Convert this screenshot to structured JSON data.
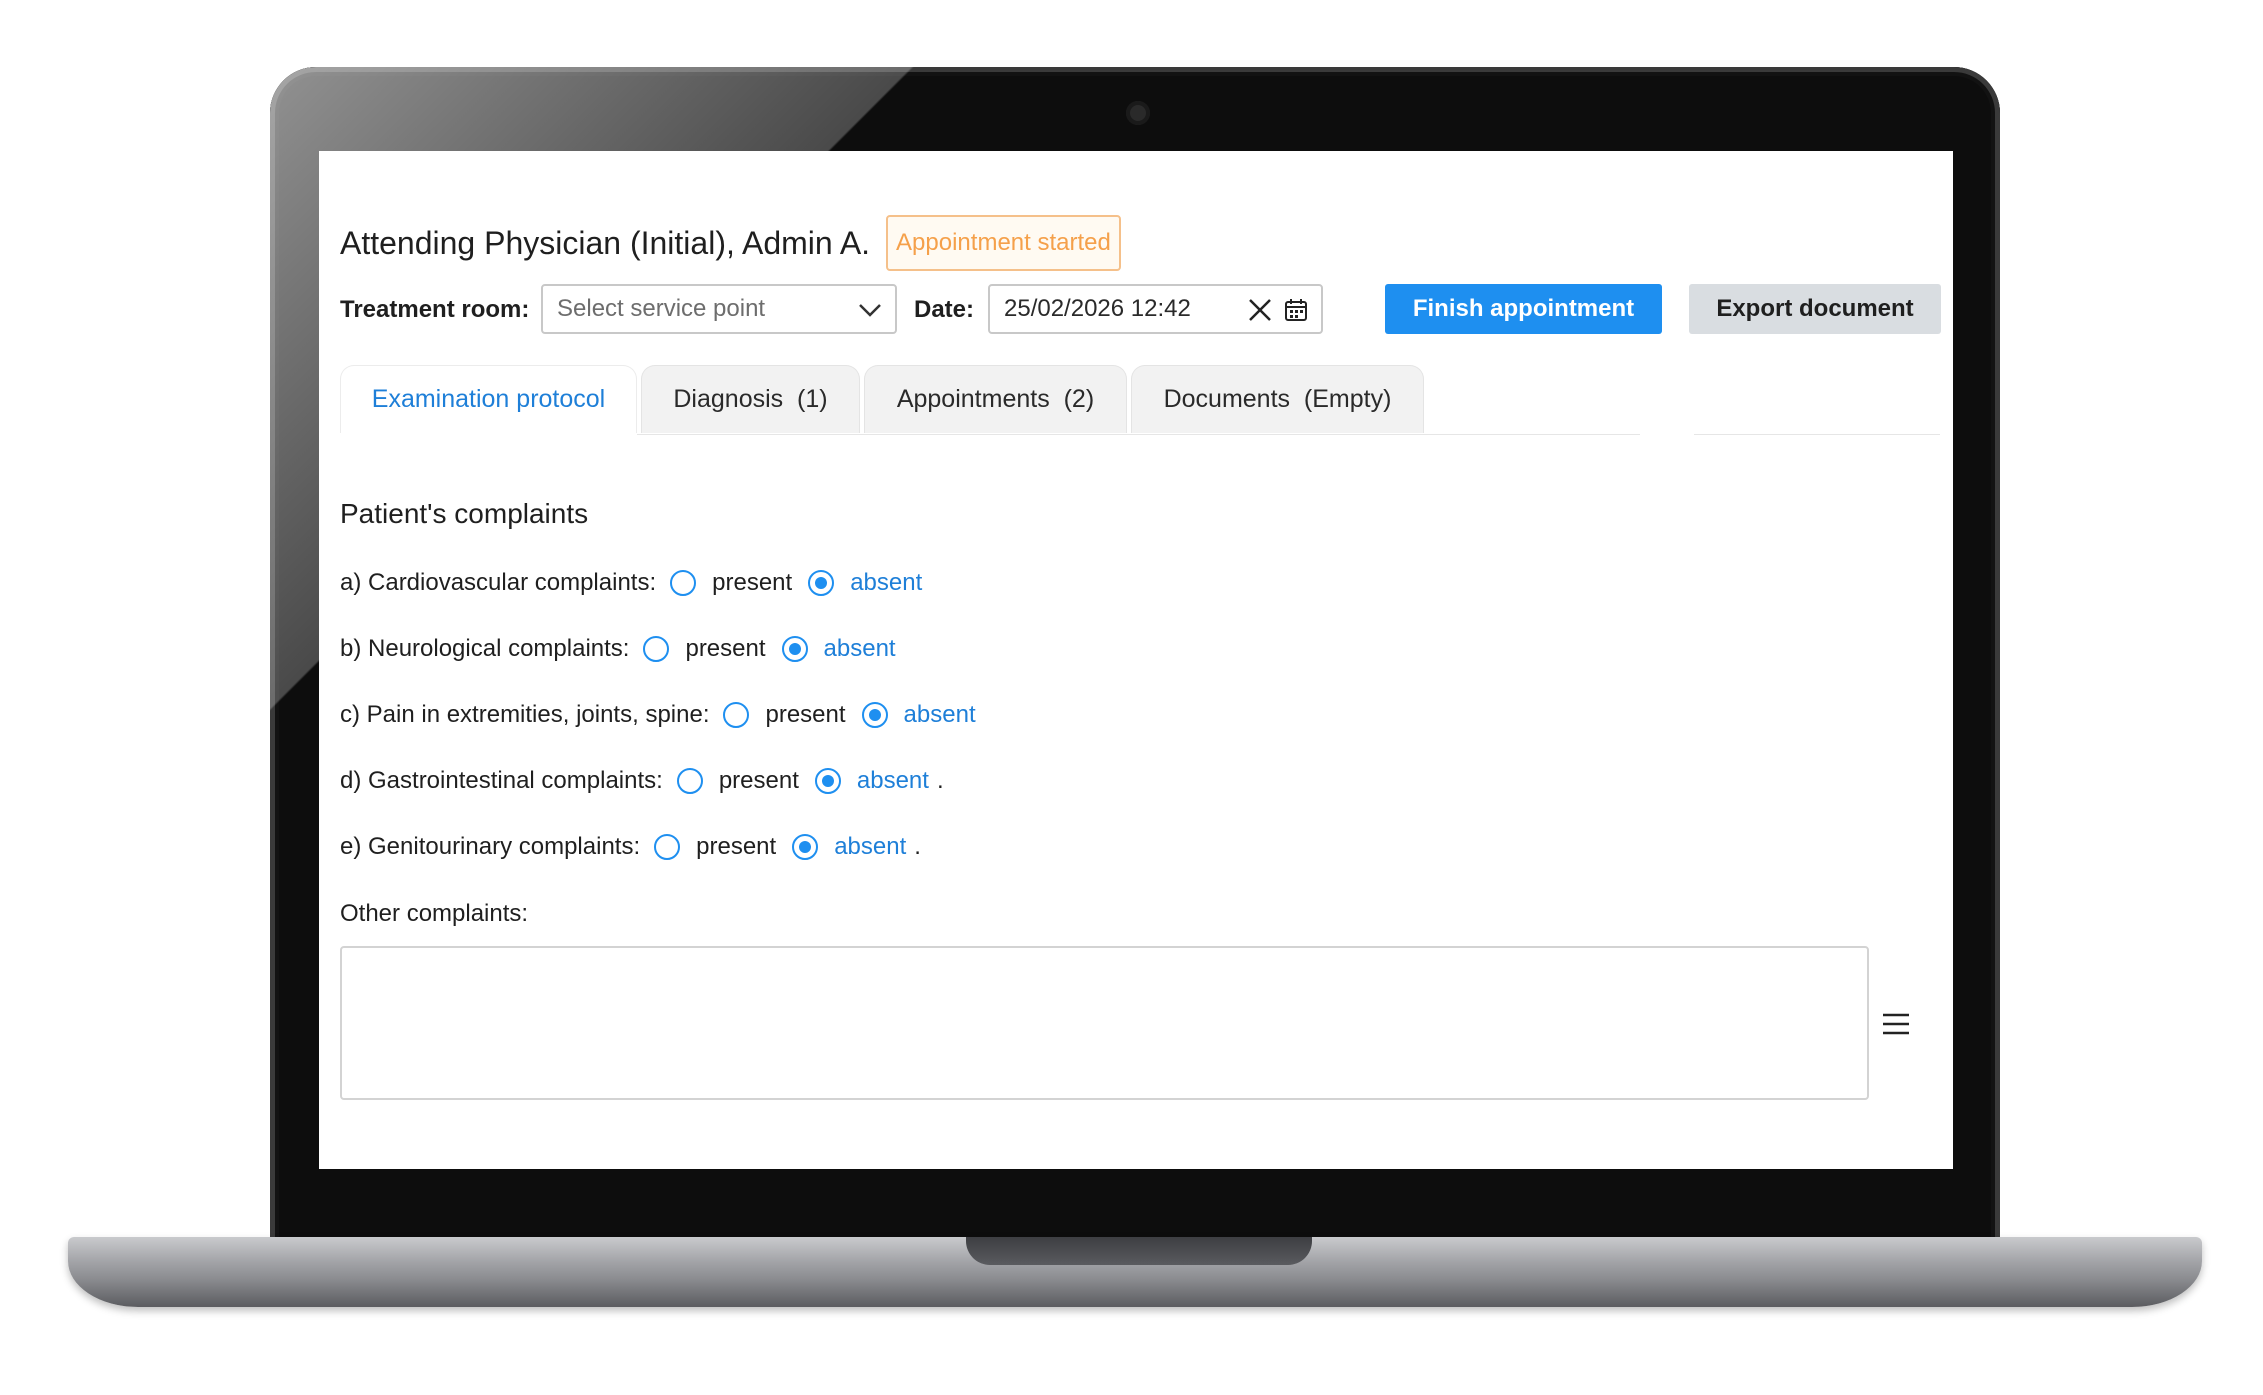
{
  "header": {
    "title": "Attending Physician (Initial), Admin A.",
    "status_badge": "Appointment started"
  },
  "toolbar": {
    "treatment_room_label": "Treatment room:",
    "service_point_placeholder": "Select service point",
    "date_label": "Date:",
    "date_value": "25/02/2026 12:42",
    "finish_button": "Finish appointment",
    "export_button": "Export document"
  },
  "tabs": [
    {
      "label": "Examination protocol",
      "active": true
    },
    {
      "label": "Diagnosis  (1)",
      "active": false
    },
    {
      "label": "Appointments  (2)",
      "active": false
    },
    {
      "label": "Documents  (Empty)",
      "active": false
    }
  ],
  "complaints": {
    "section_title": "Patient's complaints",
    "option_present": "present",
    "option_absent": "absent",
    "items": [
      {
        "label": "a) Cardiovascular complaints:",
        "selected": "absent",
        "suffix": ""
      },
      {
        "label": "b) Neurological complaints:",
        "selected": "absent",
        "suffix": ""
      },
      {
        "label": "c) Pain in extremities, joints, spine:",
        "selected": "absent",
        "suffix": ""
      },
      {
        "label": "d) Gastrointestinal complaints:",
        "selected": "absent",
        "suffix": "."
      },
      {
        "label": "e) Genitourinary complaints:",
        "selected": "absent",
        "suffix": "."
      }
    ],
    "other_label": "Other complaints:",
    "other_value": ""
  },
  "colors": {
    "accent": "#1e8ff0",
    "status_orange": "#f5a04a",
    "secondary_button": "#d9dde1"
  },
  "icons": {
    "dropdown": "chevron-down-icon",
    "clear": "close-icon",
    "calendar": "calendar-icon",
    "menu": "hamburger-menu-icon"
  }
}
